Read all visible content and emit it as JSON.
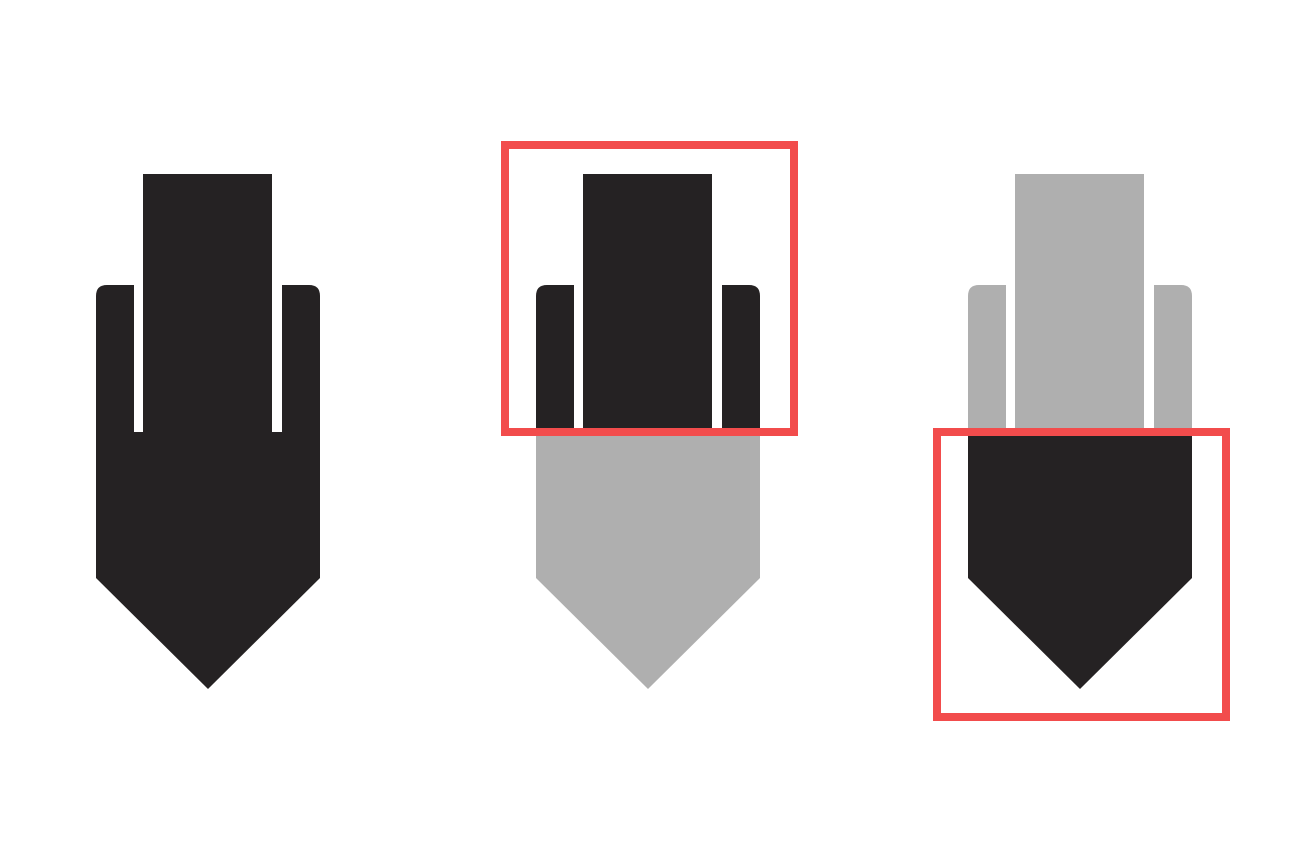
{
  "colors": {
    "background": "#ffffff",
    "dark": "#252223",
    "muted": "#afafaf",
    "highlight": "#f24c4c"
  },
  "figures": [
    {
      "name": "full-icon",
      "icon": "pen-nib-down-arrow-icon",
      "top_part_color": "#252223",
      "bottom_part_color": "#252223",
      "highlight_box": "none"
    },
    {
      "name": "top-part-highlighted",
      "icon": "pen-nib-down-arrow-icon",
      "top_part_color": "#252223",
      "bottom_part_color": "#afafaf",
      "highlight_box": "top"
    },
    {
      "name": "bottom-part-highlighted",
      "icon": "pen-nib-down-arrow-icon",
      "top_part_color": "#afafaf",
      "bottom_part_color": "#252223",
      "highlight_box": "bottom"
    }
  ]
}
